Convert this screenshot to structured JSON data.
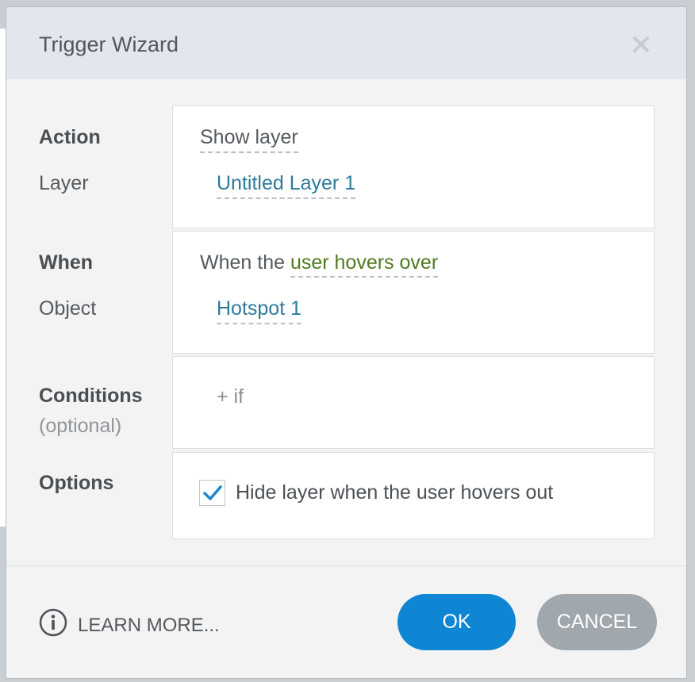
{
  "dialog": {
    "title": "Trigger Wizard",
    "close_icon": "close-icon"
  },
  "action": {
    "label": "Action",
    "value": "Show layer",
    "layer_label": "Layer",
    "layer_value": "Untitled Layer 1"
  },
  "when": {
    "label": "When",
    "prefix": "When the ",
    "event": "user hovers over",
    "object_label": "Object",
    "object_value": "Hotspot 1"
  },
  "conditions": {
    "label": "Conditions",
    "sublabel": "(optional)",
    "add_if": "+ if"
  },
  "options": {
    "label": "Options",
    "checkbox_checked": true,
    "checkbox_label": "Hide layer when the user hovers out"
  },
  "footer": {
    "learn_more": "LEARN MORE...",
    "ok": "OK",
    "cancel": "CANCEL"
  },
  "colors": {
    "ok_button": "#0e86d4",
    "cancel_button": "#a0a7ad",
    "link_blue": "#2d7a9b",
    "event_green": "#4e7a22"
  }
}
